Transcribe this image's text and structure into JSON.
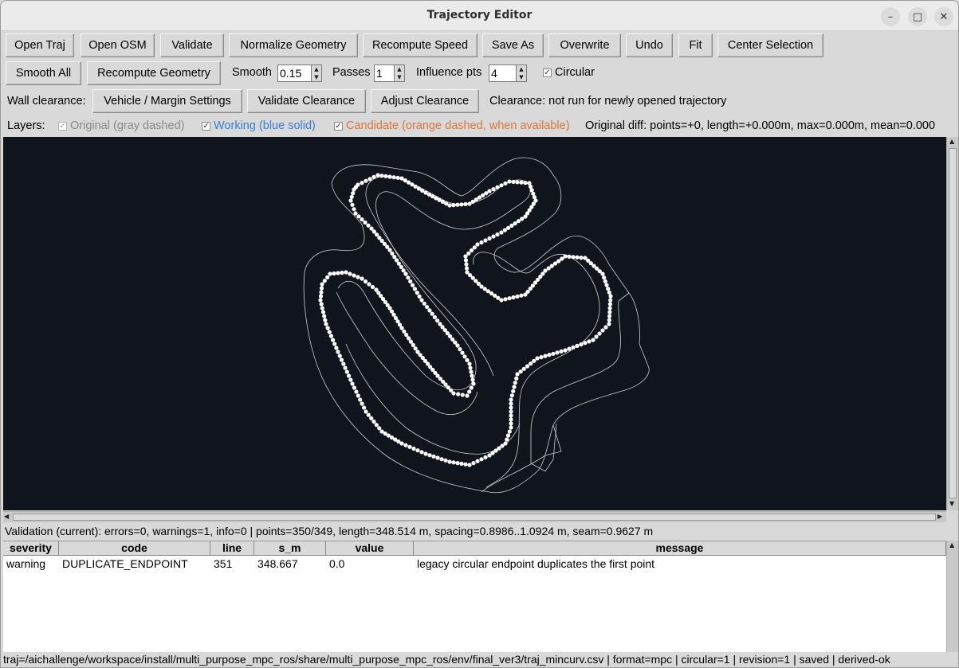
{
  "window": {
    "title": "Trajectory Editor",
    "controls": [
      "minimize",
      "maximize",
      "close"
    ]
  },
  "toolbar1": {
    "buttons": [
      "Open Traj",
      "Open OSM",
      "Validate",
      "Normalize Geometry",
      "Recompute Speed",
      "Save As",
      "Overwrite",
      "Undo",
      "Fit",
      "Center Selection"
    ]
  },
  "toolbar2": {
    "smooth_all": "Smooth All",
    "recompute_geometry": "Recompute Geometry",
    "smooth_label": "Smooth",
    "smooth_value": "0.15",
    "passes_label": "Passes",
    "passes_value": "1",
    "influence_label": "Influence pts",
    "influence_value": "4",
    "circular_label": "Circular",
    "circular_checked": true
  },
  "clearance": {
    "label": "Wall clearance:",
    "vehicle_button": "Vehicle / Margin Settings",
    "validate_button": "Validate Clearance",
    "adjust_button": "Adjust Clearance",
    "status": "Clearance: not run for newly opened trajectory"
  },
  "layers": {
    "label": "Layers:",
    "original": "Original (gray dashed)",
    "working": "Working (blue solid)",
    "candidate": "Candidate (orange dashed, when available)",
    "diff": "Original diff: points=+0, length=+0.000m, max=0.000m, mean=0.000",
    "colors": {
      "original": "#8a8a8a",
      "working": "#3b7fd4",
      "candidate": "#d9773a"
    }
  },
  "canvas": {
    "background": "#10141c",
    "track_color": "#cfcfcf",
    "point_color": "#ffffff"
  },
  "validation": {
    "summary": "Validation (current): errors=0, warnings=1, info=0 | points=350/349, length=348.514 m, spacing=0.8986..1.0924 m, seam=0.9627 m",
    "columns": [
      "severity",
      "code",
      "line",
      "s_m",
      "value",
      "message"
    ],
    "rows": [
      {
        "severity": "warning",
        "code": "DUPLICATE_ENDPOINT",
        "line": "351",
        "s_m": "348.667",
        "value": "0.0",
        "message": "legacy circular endpoint duplicates the first point"
      }
    ]
  },
  "footer": {
    "status": "traj=/aichallenge/workspace/install/multi_purpose_mpc_ros/share/multi_purpose_mpc_ros/env/final_ver3/traj_mincurv.csv | format=mpc | circular=1 | revision=1 | saved | derived-ok"
  }
}
